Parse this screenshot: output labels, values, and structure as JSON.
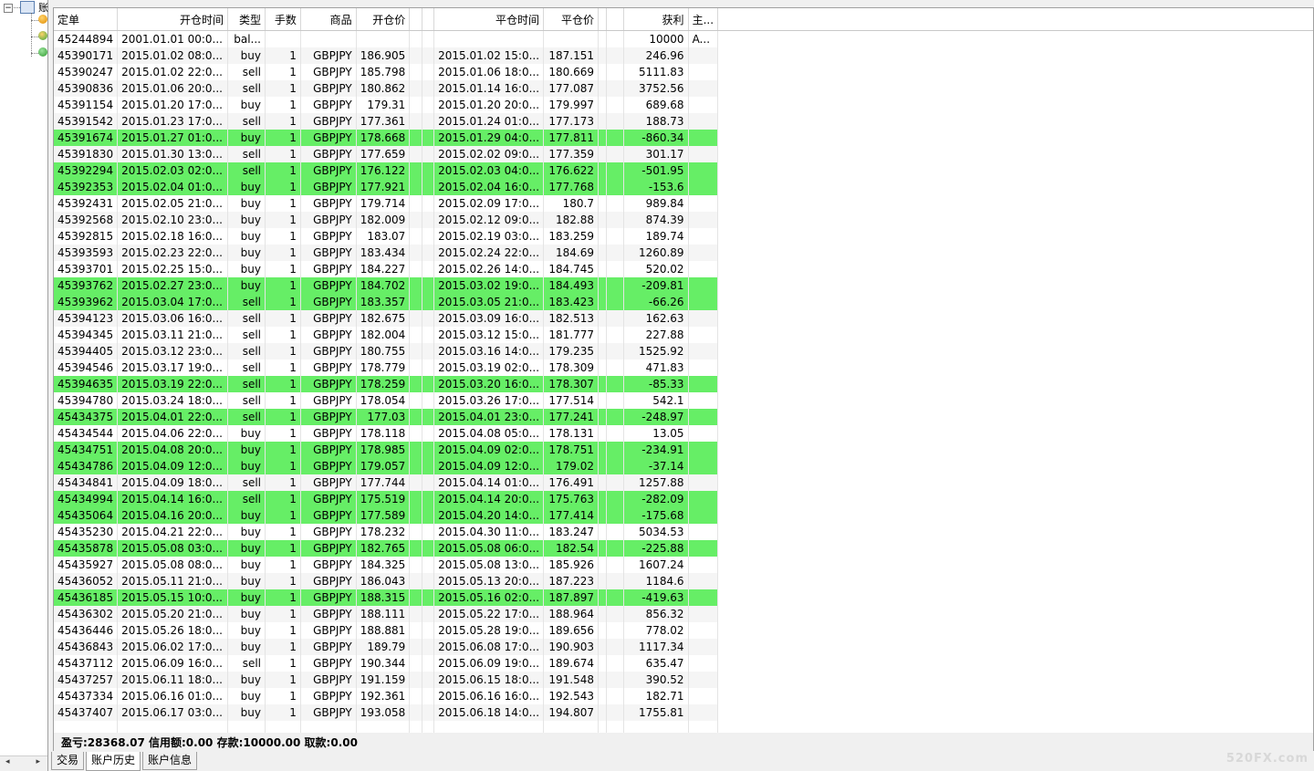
{
  "navigator": {
    "root_label": "账",
    "accounts": 3
  },
  "columns": [
    "定单",
    "开仓时间",
    "类型",
    "手数",
    "商品",
    "开仓价",
    "",
    "",
    "平仓时间",
    "平仓价",
    "",
    "",
    "获利",
    "主..."
  ],
  "rows": [
    {
      "order": "45244894",
      "open_time": "2001.01.01 00:0...",
      "type": "bal...",
      "lots": "",
      "symbol": "",
      "open_price": "",
      "close_time": "",
      "close_price": "",
      "profit": "10000",
      "comment": "A...",
      "loss": false
    },
    {
      "order": "45390171",
      "open_time": "2015.01.02 08:0...",
      "type": "buy",
      "lots": "1",
      "symbol": "GBPJPY",
      "open_price": "186.905",
      "close_time": "2015.01.02 15:0...",
      "close_price": "187.151",
      "profit": "246.96",
      "comment": "",
      "loss": false
    },
    {
      "order": "45390247",
      "open_time": "2015.01.02 22:0...",
      "type": "sell",
      "lots": "1",
      "symbol": "GBPJPY",
      "open_price": "185.798",
      "close_time": "2015.01.06 18:0...",
      "close_price": "180.669",
      "profit": "5111.83",
      "comment": "",
      "loss": false
    },
    {
      "order": "45390836",
      "open_time": "2015.01.06 20:0...",
      "type": "sell",
      "lots": "1",
      "symbol": "GBPJPY",
      "open_price": "180.862",
      "close_time": "2015.01.14 16:0...",
      "close_price": "177.087",
      "profit": "3752.56",
      "comment": "",
      "loss": false
    },
    {
      "order": "45391154",
      "open_time": "2015.01.20 17:0...",
      "type": "buy",
      "lots": "1",
      "symbol": "GBPJPY",
      "open_price": "179.31",
      "close_time": "2015.01.20 20:0...",
      "close_price": "179.997",
      "profit": "689.68",
      "comment": "",
      "loss": false
    },
    {
      "order": "45391542",
      "open_time": "2015.01.23 17:0...",
      "type": "sell",
      "lots": "1",
      "symbol": "GBPJPY",
      "open_price": "177.361",
      "close_time": "2015.01.24 01:0...",
      "close_price": "177.173",
      "profit": "188.73",
      "comment": "",
      "loss": false
    },
    {
      "order": "45391674",
      "open_time": "2015.01.27 01:0...",
      "type": "buy",
      "lots": "1",
      "symbol": "GBPJPY",
      "open_price": "178.668",
      "close_time": "2015.01.29 04:0...",
      "close_price": "177.811",
      "profit": "-860.34",
      "comment": "",
      "loss": true
    },
    {
      "order": "45391830",
      "open_time": "2015.01.30 13:0...",
      "type": "sell",
      "lots": "1",
      "symbol": "GBPJPY",
      "open_price": "177.659",
      "close_time": "2015.02.02 09:0...",
      "close_price": "177.359",
      "profit": "301.17",
      "comment": "",
      "loss": false
    },
    {
      "order": "45392294",
      "open_time": "2015.02.03 02:0...",
      "type": "sell",
      "lots": "1",
      "symbol": "GBPJPY",
      "open_price": "176.122",
      "close_time": "2015.02.03 04:0...",
      "close_price": "176.622",
      "profit": "-501.95",
      "comment": "",
      "loss": true
    },
    {
      "order": "45392353",
      "open_time": "2015.02.04 01:0...",
      "type": "buy",
      "lots": "1",
      "symbol": "GBPJPY",
      "open_price": "177.921",
      "close_time": "2015.02.04 16:0...",
      "close_price": "177.768",
      "profit": "-153.6",
      "comment": "",
      "loss": true
    },
    {
      "order": "45392431",
      "open_time": "2015.02.05 21:0...",
      "type": "buy",
      "lots": "1",
      "symbol": "GBPJPY",
      "open_price": "179.714",
      "close_time": "2015.02.09 17:0...",
      "close_price": "180.7",
      "profit": "989.84",
      "comment": "",
      "loss": false
    },
    {
      "order": "45392568",
      "open_time": "2015.02.10 23:0...",
      "type": "buy",
      "lots": "1",
      "symbol": "GBPJPY",
      "open_price": "182.009",
      "close_time": "2015.02.12 09:0...",
      "close_price": "182.88",
      "profit": "874.39",
      "comment": "",
      "loss": false
    },
    {
      "order": "45392815",
      "open_time": "2015.02.18 16:0...",
      "type": "buy",
      "lots": "1",
      "symbol": "GBPJPY",
      "open_price": "183.07",
      "close_time": "2015.02.19 03:0...",
      "close_price": "183.259",
      "profit": "189.74",
      "comment": "",
      "loss": false
    },
    {
      "order": "45393593",
      "open_time": "2015.02.23 22:0...",
      "type": "buy",
      "lots": "1",
      "symbol": "GBPJPY",
      "open_price": "183.434",
      "close_time": "2015.02.24 22:0...",
      "close_price": "184.69",
      "profit": "1260.89",
      "comment": "",
      "loss": false
    },
    {
      "order": "45393701",
      "open_time": "2015.02.25 15:0...",
      "type": "buy",
      "lots": "1",
      "symbol": "GBPJPY",
      "open_price": "184.227",
      "close_time": "2015.02.26 14:0...",
      "close_price": "184.745",
      "profit": "520.02",
      "comment": "",
      "loss": false
    },
    {
      "order": "45393762",
      "open_time": "2015.02.27 23:0...",
      "type": "buy",
      "lots": "1",
      "symbol": "GBPJPY",
      "open_price": "184.702",
      "close_time": "2015.03.02 19:0...",
      "close_price": "184.493",
      "profit": "-209.81",
      "comment": "",
      "loss": true
    },
    {
      "order": "45393962",
      "open_time": "2015.03.04 17:0...",
      "type": "sell",
      "lots": "1",
      "symbol": "GBPJPY",
      "open_price": "183.357",
      "close_time": "2015.03.05 21:0...",
      "close_price": "183.423",
      "profit": "-66.26",
      "comment": "",
      "loss": true
    },
    {
      "order": "45394123",
      "open_time": "2015.03.06 16:0...",
      "type": "sell",
      "lots": "1",
      "symbol": "GBPJPY",
      "open_price": "182.675",
      "close_time": "2015.03.09 16:0...",
      "close_price": "182.513",
      "profit": "162.63",
      "comment": "",
      "loss": false
    },
    {
      "order": "45394345",
      "open_time": "2015.03.11 21:0...",
      "type": "sell",
      "lots": "1",
      "symbol": "GBPJPY",
      "open_price": "182.004",
      "close_time": "2015.03.12 15:0...",
      "close_price": "181.777",
      "profit": "227.88",
      "comment": "",
      "loss": false
    },
    {
      "order": "45394405",
      "open_time": "2015.03.12 23:0...",
      "type": "sell",
      "lots": "1",
      "symbol": "GBPJPY",
      "open_price": "180.755",
      "close_time": "2015.03.16 14:0...",
      "close_price": "179.235",
      "profit": "1525.92",
      "comment": "",
      "loss": false
    },
    {
      "order": "45394546",
      "open_time": "2015.03.17 19:0...",
      "type": "sell",
      "lots": "1",
      "symbol": "GBPJPY",
      "open_price": "178.779",
      "close_time": "2015.03.19 02:0...",
      "close_price": "178.309",
      "profit": "471.83",
      "comment": "",
      "loss": false
    },
    {
      "order": "45394635",
      "open_time": "2015.03.19 22:0...",
      "type": "sell",
      "lots": "1",
      "symbol": "GBPJPY",
      "open_price": "178.259",
      "close_time": "2015.03.20 16:0...",
      "close_price": "178.307",
      "profit": "-85.33",
      "comment": "",
      "loss": true
    },
    {
      "order": "45394780",
      "open_time": "2015.03.24 18:0...",
      "type": "sell",
      "lots": "1",
      "symbol": "GBPJPY",
      "open_price": "178.054",
      "close_time": "2015.03.26 17:0...",
      "close_price": "177.514",
      "profit": "542.1",
      "comment": "",
      "loss": false
    },
    {
      "order": "45434375",
      "open_time": "2015.04.01 22:0...",
      "type": "sell",
      "lots": "1",
      "symbol": "GBPJPY",
      "open_price": "177.03",
      "close_time": "2015.04.01 23:0...",
      "close_price": "177.241",
      "profit": "-248.97",
      "comment": "",
      "loss": true
    },
    {
      "order": "45434544",
      "open_time": "2015.04.06 22:0...",
      "type": "buy",
      "lots": "1",
      "symbol": "GBPJPY",
      "open_price": "178.118",
      "close_time": "2015.04.08 05:0...",
      "close_price": "178.131",
      "profit": "13.05",
      "comment": "",
      "loss": false
    },
    {
      "order": "45434751",
      "open_time": "2015.04.08 20:0...",
      "type": "buy",
      "lots": "1",
      "symbol": "GBPJPY",
      "open_price": "178.985",
      "close_time": "2015.04.09 02:0...",
      "close_price": "178.751",
      "profit": "-234.91",
      "comment": "",
      "loss": true
    },
    {
      "order": "45434786",
      "open_time": "2015.04.09 12:0...",
      "type": "buy",
      "lots": "1",
      "symbol": "GBPJPY",
      "open_price": "179.057",
      "close_time": "2015.04.09 12:0...",
      "close_price": "179.02",
      "profit": "-37.14",
      "comment": "",
      "loss": true
    },
    {
      "order": "45434841",
      "open_time": "2015.04.09 18:0...",
      "type": "sell",
      "lots": "1",
      "symbol": "GBPJPY",
      "open_price": "177.744",
      "close_time": "2015.04.14 01:0...",
      "close_price": "176.491",
      "profit": "1257.88",
      "comment": "",
      "loss": false
    },
    {
      "order": "45434994",
      "open_time": "2015.04.14 16:0...",
      "type": "sell",
      "lots": "1",
      "symbol": "GBPJPY",
      "open_price": "175.519",
      "close_time": "2015.04.14 20:0...",
      "close_price": "175.763",
      "profit": "-282.09",
      "comment": "",
      "loss": true
    },
    {
      "order": "45435064",
      "open_time": "2015.04.16 20:0...",
      "type": "buy",
      "lots": "1",
      "symbol": "GBPJPY",
      "open_price": "177.589",
      "close_time": "2015.04.20 14:0...",
      "close_price": "177.414",
      "profit": "-175.68",
      "comment": "",
      "loss": true
    },
    {
      "order": "45435230",
      "open_time": "2015.04.21 22:0...",
      "type": "buy",
      "lots": "1",
      "symbol": "GBPJPY",
      "open_price": "178.232",
      "close_time": "2015.04.30 11:0...",
      "close_price": "183.247",
      "profit": "5034.53",
      "comment": "",
      "loss": false
    },
    {
      "order": "45435878",
      "open_time": "2015.05.08 03:0...",
      "type": "buy",
      "lots": "1",
      "symbol": "GBPJPY",
      "open_price": "182.765",
      "close_time": "2015.05.08 06:0...",
      "close_price": "182.54",
      "profit": "-225.88",
      "comment": "",
      "loss": true
    },
    {
      "order": "45435927",
      "open_time": "2015.05.08 08:0...",
      "type": "buy",
      "lots": "1",
      "symbol": "GBPJPY",
      "open_price": "184.325",
      "close_time": "2015.05.08 13:0...",
      "close_price": "185.926",
      "profit": "1607.24",
      "comment": "",
      "loss": false
    },
    {
      "order": "45436052",
      "open_time": "2015.05.11 21:0...",
      "type": "buy",
      "lots": "1",
      "symbol": "GBPJPY",
      "open_price": "186.043",
      "close_time": "2015.05.13 20:0...",
      "close_price": "187.223",
      "profit": "1184.6",
      "comment": "",
      "loss": false
    },
    {
      "order": "45436185",
      "open_time": "2015.05.15 10:0...",
      "type": "buy",
      "lots": "1",
      "symbol": "GBPJPY",
      "open_price": "188.315",
      "close_time": "2015.05.16 02:0...",
      "close_price": "187.897",
      "profit": "-419.63",
      "comment": "",
      "loss": true
    },
    {
      "order": "45436302",
      "open_time": "2015.05.20 21:0...",
      "type": "buy",
      "lots": "1",
      "symbol": "GBPJPY",
      "open_price": "188.111",
      "close_time": "2015.05.22 17:0...",
      "close_price": "188.964",
      "profit": "856.32",
      "comment": "",
      "loss": false
    },
    {
      "order": "45436446",
      "open_time": "2015.05.26 18:0...",
      "type": "buy",
      "lots": "1",
      "symbol": "GBPJPY",
      "open_price": "188.881",
      "close_time": "2015.05.28 19:0...",
      "close_price": "189.656",
      "profit": "778.02",
      "comment": "",
      "loss": false
    },
    {
      "order": "45436843",
      "open_time": "2015.06.02 17:0...",
      "type": "buy",
      "lots": "1",
      "symbol": "GBPJPY",
      "open_price": "189.79",
      "close_time": "2015.06.08 17:0...",
      "close_price": "190.903",
      "profit": "1117.34",
      "comment": "",
      "loss": false
    },
    {
      "order": "45437112",
      "open_time": "2015.06.09 16:0...",
      "type": "sell",
      "lots": "1",
      "symbol": "GBPJPY",
      "open_price": "190.344",
      "close_time": "2015.06.09 19:0...",
      "close_price": "189.674",
      "profit": "635.47",
      "comment": "",
      "loss": false
    },
    {
      "order": "45437257",
      "open_time": "2015.06.11 18:0...",
      "type": "buy",
      "lots": "1",
      "symbol": "GBPJPY",
      "open_price": "191.159",
      "close_time": "2015.06.15 18:0...",
      "close_price": "191.548",
      "profit": "390.52",
      "comment": "",
      "loss": false
    },
    {
      "order": "45437334",
      "open_time": "2015.06.16 01:0...",
      "type": "buy",
      "lots": "1",
      "symbol": "GBPJPY",
      "open_price": "192.361",
      "close_time": "2015.06.16 16:0...",
      "close_price": "192.543",
      "profit": "182.71",
      "comment": "",
      "loss": false
    },
    {
      "order": "45437407",
      "open_time": "2015.06.17 03:0...",
      "type": "buy",
      "lots": "1",
      "symbol": "GBPJPY",
      "open_price": "193.058",
      "close_time": "2015.06.18 14:0...",
      "close_price": "194.807",
      "profit": "1755.81",
      "comment": "",
      "loss": false
    }
  ],
  "summary": "盈亏:28368.07 信用额:0.00 存款:10000.00 取款:0.00",
  "tabs": [
    {
      "label": "交易",
      "active": false
    },
    {
      "label": "账户历史",
      "active": true
    },
    {
      "label": "账户信息",
      "active": false
    }
  ],
  "watermark": "520FX.com",
  "colors": {
    "loss_row": "#66ee66",
    "even_row": "#f5f5f5",
    "odd_row": "#ffffff"
  }
}
